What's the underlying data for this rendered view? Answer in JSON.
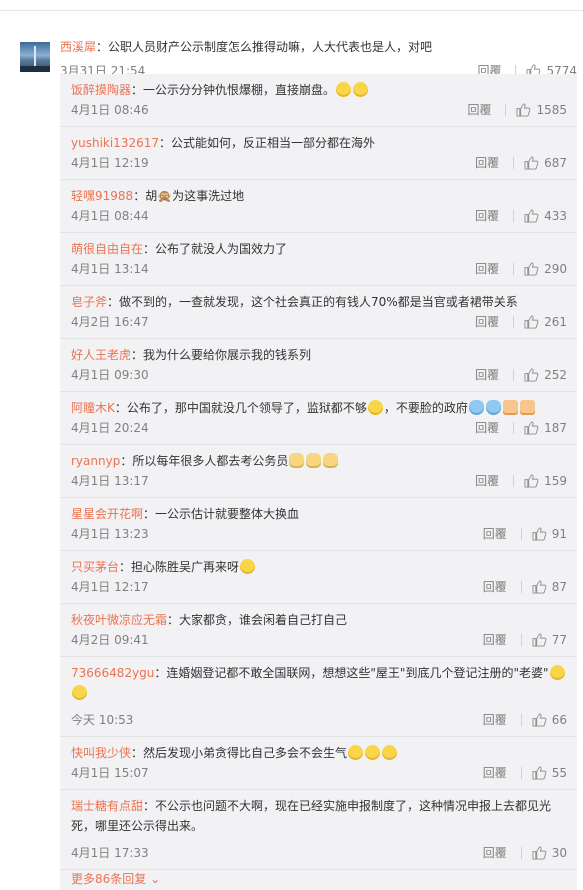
{
  "root": {
    "username": "西溪犀",
    "text": "：公职人员财产公示制度怎么推得动嘛，人大代表也是人，对吧",
    "time": "3月31日 21:54",
    "reply_label": "回覆",
    "likes": "5774"
  },
  "replies": [
    {
      "user": "饭醉摸陶器",
      "text": "：一公示分分钟仇恨爆棚，直接崩盘。",
      "time": "4月1日 08:46",
      "likes": "1585",
      "user_color": "orange",
      "emoji": [
        "cry-laugh",
        "hug"
      ]
    },
    {
      "user": "yushiki132617",
      "text": "：公式能如何，反正相当一部分都在海外",
      "time": "4月1日 12:19",
      "likes": "687",
      "user_color": "orange"
    },
    {
      "user": "轻嘿91988",
      "text": "：胡🙊为这事洗过地",
      "time": "4月1日 08:44",
      "likes": "433",
      "user_color": "orange"
    },
    {
      "user": "萌很自由自在",
      "text": "：公布了就没人为国效力了",
      "time": "4月1日 13:14",
      "likes": "290",
      "user_color": "orange"
    },
    {
      "user": "皂子斧",
      "text": "：做不到的，一查就发现，这个社会真正的有钱人70%都是当官或者裙带关系",
      "time": "4月2日 16:47",
      "likes": "261",
      "user_color": "orange"
    },
    {
      "user": "好人王老虎",
      "text": "：我为什么要给你展示我的钱系列",
      "time": "4月1日 09:30",
      "likes": "252",
      "user_color": "orange"
    },
    {
      "user": "阿瞳木K",
      "text": "：公布了，那中国就没几个领导了，监狱都不够",
      "text2": "，不要脸的政府",
      "time": "4月1日 20:24",
      "likes": "187",
      "user_color": "orange",
      "emoji": [
        "weep",
        "weep",
        "thumbdown",
        "thumbdown"
      ]
    },
    {
      "user": "ryannyp",
      "text": "：所以每年很多人都去考公务员",
      "time": "4月1日 13:17",
      "likes": "159",
      "user_color": "orange",
      "emoji": [
        "cat",
        "cat",
        "cat"
      ]
    },
    {
      "user": "星星会开花啊",
      "text": "：一公示估计就要整体大换血",
      "time": "4月1日 13:23",
      "likes": "91",
      "user_color": "orange"
    },
    {
      "user": "只买茅台",
      "text": "：担心陈胜吴广再来呀",
      "time": "4月1日 12:17",
      "likes": "87",
      "user_color": "orange",
      "emoji": [
        "laugh"
      ]
    },
    {
      "user": "秋夜叶微凉应无霜",
      "text": "：大家都贪，谁会闲着自己打自己",
      "time": "4月2日 09:41",
      "likes": "77",
      "user_color": "orange"
    },
    {
      "user": "73666482ygu",
      "text": "：连婚姻登记都不敢全国联网，想想这些\"屋王\"到底几个登记注册的\"老婆\"",
      "time": "今天 10:53",
      "likes": "66",
      "user_color": "orange",
      "tall": true,
      "emoji": [
        "smirk",
        "smirk"
      ]
    },
    {
      "user": "快叫我少侠",
      "text": "：然后发现小弟贪得比自己多会不会生气",
      "time": "4月1日 15:07",
      "likes": "55",
      "user_color": "orange",
      "emoji": [
        "cry-laugh",
        "cry-laugh",
        "cry-laugh"
      ]
    },
    {
      "user": "瑞士糖有点甜",
      "text": "：不公示也问题不大啊，现在已经实施申报制度了，这种情况申报上去都见光死，哪里还公示得出来。",
      "time": "4月1日 17:33",
      "likes": "30",
      "user_color": "orange",
      "tall": true
    }
  ],
  "more_label": "更多86条回复",
  "icons": {
    "like": "thumbs-up-icon",
    "arrow": "chevron-down-icon"
  },
  "colors": {
    "username": "#eb7350",
    "time": "#808080",
    "reply_bg": "#f2f2f5"
  }
}
